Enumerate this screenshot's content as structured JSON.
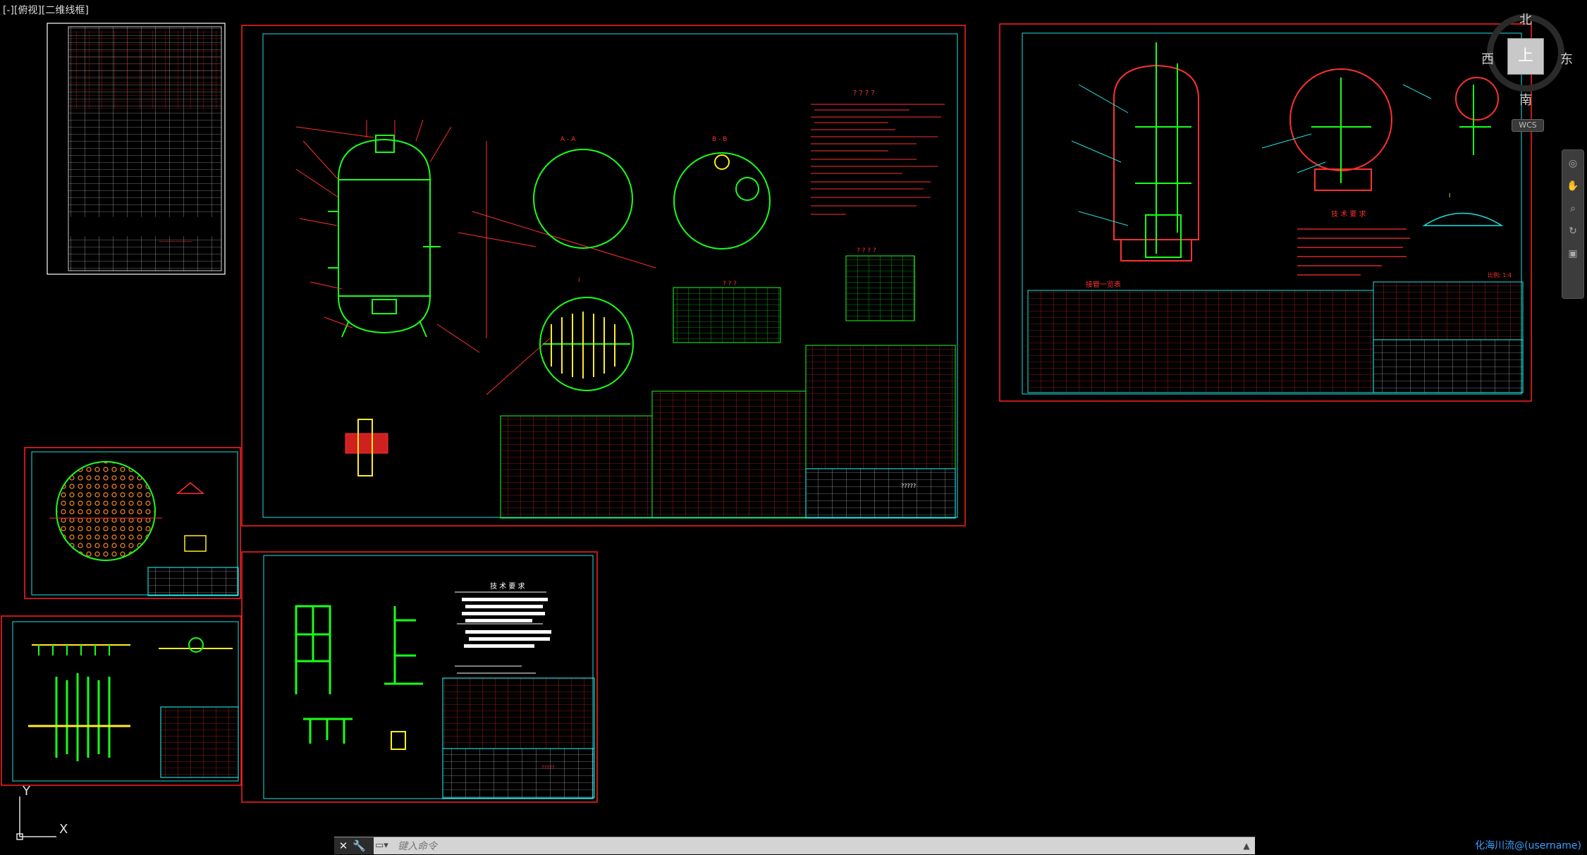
{
  "view_label": "[-][俯视][二维线框]",
  "viewcube": {
    "north": "北",
    "south": "南",
    "east": "东",
    "west": "西",
    "face": "上",
    "wcs": "WCS"
  },
  "ucs": {
    "x_label": "X",
    "y_label": "Y"
  },
  "command_line": {
    "placeholder": "键入命令",
    "close_symbol": "✕",
    "settings_symbol": "🔧",
    "prompt_symbol": "▭▾",
    "history_symbol": "▲"
  },
  "drawing_sheets": [
    {
      "name": "parts-list-sheet"
    },
    {
      "name": "main-vessel-sheet"
    },
    {
      "name": "assembly-sheet"
    },
    {
      "name": "tube-plate-sheet"
    },
    {
      "name": "distributor-sheet"
    },
    {
      "name": "support-frame-sheet"
    }
  ],
  "tech_req_title": "技术要求",
  "sheet_texts": {
    "main_req_heading": "? ? ? ?",
    "main_note_title": "? ? ? ?",
    "main_table_title": "? ? ?",
    "assembly_req_title": "技 术 要 求",
    "assembly_list_title": "接管一览表",
    "frame_req_title": "技 术 要 求",
    "frame_title_block": "?????",
    "assembly_scale": "比例: 1:4",
    "section_labels": [
      "A - A",
      "B - B",
      "I"
    ],
    "main_title_block": "?????"
  },
  "colors": {
    "background": "#000000",
    "sheet_border": "#ff2020",
    "inner_frame": "#20e0e0",
    "geometry": "#18ff18",
    "annotation": "#ff3030",
    "title_block": "#20ffff",
    "white_text": "#ffffff"
  },
  "watermark": "化海川流@(username)"
}
